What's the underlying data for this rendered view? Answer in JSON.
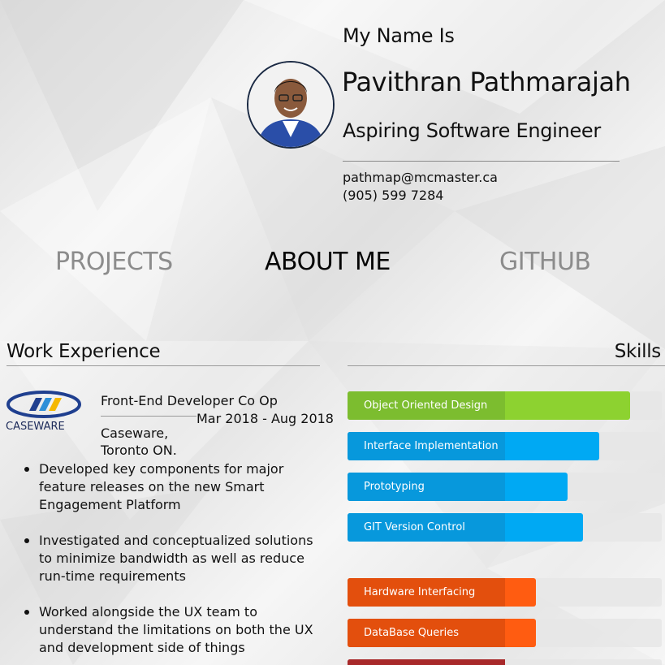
{
  "header": {
    "intro": "My Name Is",
    "name": "Pavithran Pathmarajah",
    "role": "Aspiring Software Engineer",
    "email": "pathmap@mcmaster.ca",
    "phone": "(905) 599 7284"
  },
  "nav": {
    "projects": "PROJECTS",
    "about": "ABOUT ME",
    "github": "GITHUB"
  },
  "work": {
    "title": "Work Experience",
    "logo_text": "CASEWARE",
    "job": {
      "title": "Front-End Developer Co Op",
      "dates": "Mar 2018 - Aug 2018",
      "company": "Caseware,",
      "location": "Toronto ON."
    },
    "bullets": [
      "Developed key components for major feature releases on the new Smart Engagement Platform",
      "Investigated and conceptualized solutions to minimize bandwidth as well as reduce run-time requirements",
      "Worked alongside the UX team to understand the limitations on both the UX and development side of things"
    ]
  },
  "skills": {
    "title": "Skills",
    "items": [
      {
        "label": "Object Oriented Design",
        "level": 0.9,
        "fill": "#8dd230",
        "label_bg": "#7cbd2f"
      },
      {
        "label": "Interface Implementation",
        "level": 0.8,
        "fill": "#00a9f3",
        "label_bg": "#0798dc"
      },
      {
        "label": "Prototyping",
        "level": 0.7,
        "fill": "#00a9f3",
        "label_bg": "#0798dc"
      },
      {
        "label": "GIT Version Control",
        "level": 0.75,
        "fill": "#00a9f3",
        "label_bg": "#0798dc"
      },
      {
        "label": "Hardware Interfacing",
        "level": 0.6,
        "fill": "#ff5c11",
        "label_bg": "#e34f0d"
      },
      {
        "label": "DataBase Queries",
        "level": 0.6,
        "fill": "#ff5c11",
        "label_bg": "#e34f0d"
      },
      {
        "label": "",
        "level": 0.5,
        "fill": "#c0302f",
        "label_bg": "#a8292a"
      }
    ]
  },
  "colors": {
    "nav_inactive": "#8c8c8c",
    "nav_active": "#050505",
    "avatar_border": "#1b2a44"
  }
}
